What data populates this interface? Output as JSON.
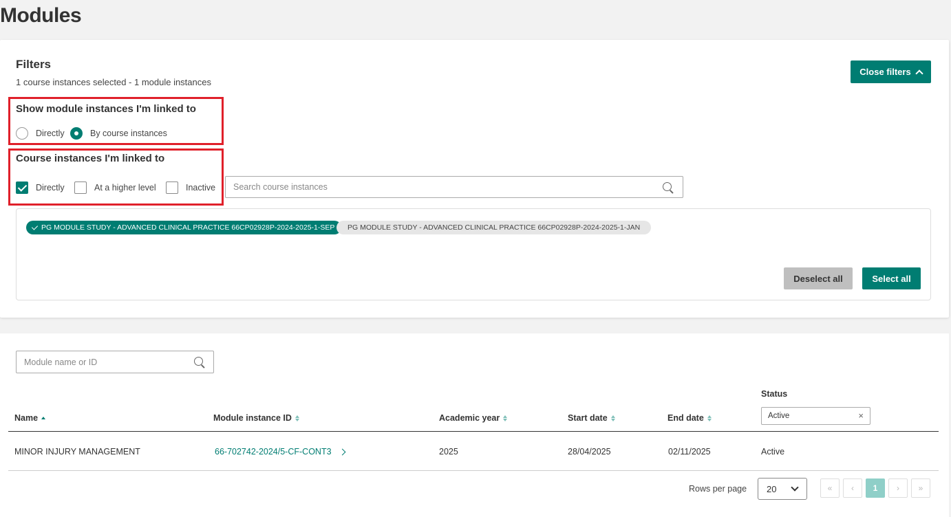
{
  "page": {
    "title": "Modules"
  },
  "filters": {
    "title": "Filters",
    "summary": "1 course instances selected - 1 module instances",
    "close_label": "Close filters",
    "link_section": {
      "heading": "Show module instances I'm linked to",
      "options": [
        {
          "label": "Directly",
          "selected": false
        },
        {
          "label": "By course instances",
          "selected": true
        }
      ]
    },
    "course_section": {
      "heading": "Course instances I'm linked to",
      "options": [
        {
          "label": "Directly",
          "checked": true
        },
        {
          "label": "At a higher level",
          "checked": false
        },
        {
          "label": "Inactive",
          "checked": false
        }
      ],
      "search_placeholder": "Search course instances"
    },
    "chips": [
      {
        "label": "PG MODULE STUDY - ADVANCED CLINICAL PRACTICE 66CP02928P-2024-2025-1-SEP",
        "selected": true
      },
      {
        "label": "PG MODULE STUDY - ADVANCED CLINICAL PRACTICE 66CP02928P-2024-2025-1-JAN",
        "selected": false
      }
    ],
    "deselect_all": "Deselect all",
    "select_all": "Select all"
  },
  "table": {
    "search_placeholder": "Module name or ID",
    "columns": [
      {
        "label": "Name",
        "sort": "asc"
      },
      {
        "label": "Module instance ID",
        "sort": "none"
      },
      {
        "label": "Academic year",
        "sort": "none"
      },
      {
        "label": "Start date",
        "sort": "none"
      },
      {
        "label": "End date",
        "sort": "none"
      },
      {
        "label": "Status",
        "sort": "none"
      }
    ],
    "status_filter": {
      "value": "Active",
      "clear_icon": "close-icon"
    },
    "rows": [
      {
        "name": "MINOR INJURY MANAGEMENT",
        "module_instance_id": "66-702742-2024/5-CF-CONT3",
        "academic_year": "2025",
        "start_date": "28/04/2025",
        "end_date": "02/11/2025",
        "status": "Active"
      }
    ]
  },
  "pagination": {
    "rows_per_page_label": "Rows per page",
    "rows_per_page": "20",
    "first": "«",
    "prev": "‹",
    "current_page": "1",
    "next": "›",
    "last": "»"
  },
  "colors": {
    "accent": "#007d72",
    "highlight": "#e0202a"
  }
}
